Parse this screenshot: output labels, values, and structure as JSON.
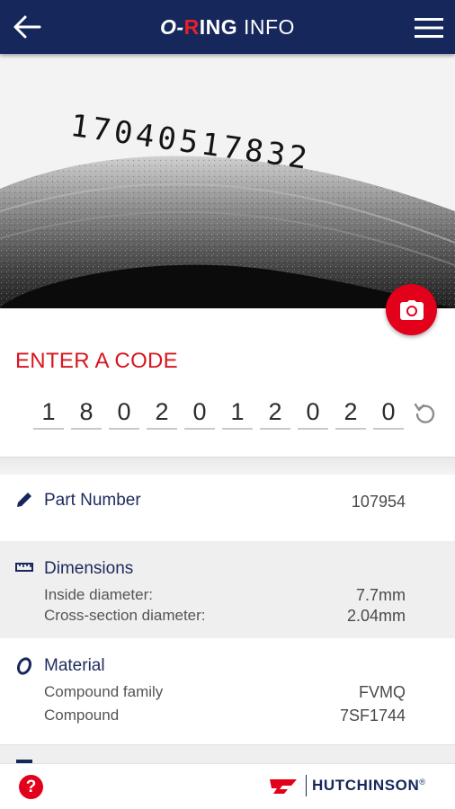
{
  "header": {
    "brand_o": "O-",
    "brand_r": "R",
    "brand_ing": "ING",
    "brand_info": " INFO",
    "back_icon": "arrow-left-icon",
    "menu_icon": "hamburger-menu-icon"
  },
  "photo": {
    "engraved_code": "17040517832"
  },
  "camera": {
    "icon": "camera-icon"
  },
  "entry": {
    "title": "ENTER A CODE",
    "digits": [
      "1",
      "8",
      "0",
      "2",
      "0",
      "1",
      "2",
      "0",
      "2",
      "0"
    ],
    "reset_icon": "reset-icon"
  },
  "part": {
    "icon": "pencil-icon",
    "label": "Part Number",
    "value": "107954"
  },
  "dimensions": {
    "icon": "ruler-icon",
    "label": "Dimensions",
    "rows": [
      {
        "label": "Inside diameter:",
        "value": "7.7mm"
      },
      {
        "label": "Cross-section diameter:",
        "value": "2.04mm"
      }
    ]
  },
  "material": {
    "icon": "o-ring-icon",
    "label": "Material",
    "rows": [
      {
        "label": "Compound family",
        "value": "FVMQ"
      },
      {
        "label": "Compound",
        "value": "7SF1744"
      }
    ]
  },
  "footer": {
    "help_label": "?",
    "logo_text": "HUTCHINSON",
    "registered": "®"
  },
  "colors": {
    "navy": "#16275b",
    "red": "#e2001a"
  }
}
